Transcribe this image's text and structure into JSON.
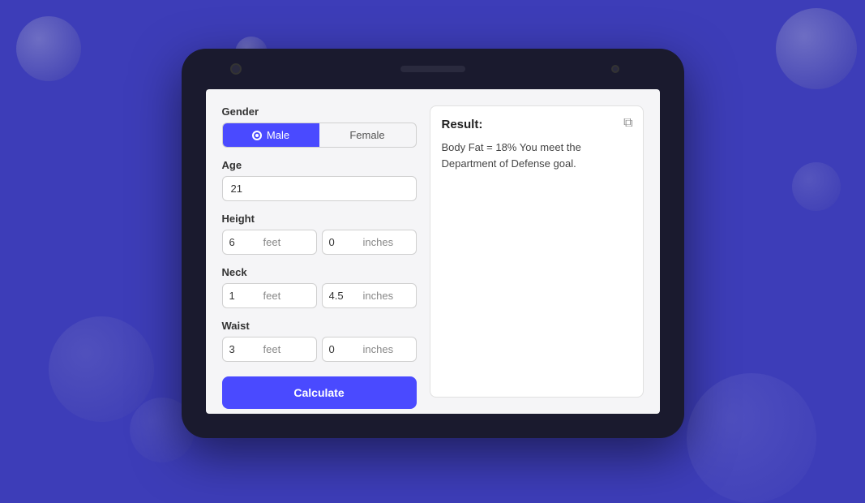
{
  "background": {
    "color": "#3d3db8"
  },
  "tablet": {
    "screen_bg": "#f5f5f7"
  },
  "form": {
    "gender_label": "Gender",
    "male_label": "Male",
    "female_label": "Female",
    "age_label": "Age",
    "age_value": "21",
    "height_label": "Height",
    "height_feet_value": "6",
    "height_feet_unit": "feet",
    "height_inches_value": "0",
    "height_inches_unit": "inches",
    "neck_label": "Neck",
    "neck_feet_value": "1",
    "neck_feet_unit": "feet",
    "neck_inches_value": "4.5",
    "neck_inches_unit": "inches",
    "waist_label": "Waist",
    "waist_feet_value": "3",
    "waist_feet_unit": "feet",
    "waist_inches_value": "0",
    "waist_inches_unit": "inches",
    "calculate_label": "Calculate"
  },
  "result": {
    "header": "Result:",
    "body": "Body Fat = 18% You meet the Department of Defense goal.",
    "copy_icon": "⧉"
  }
}
